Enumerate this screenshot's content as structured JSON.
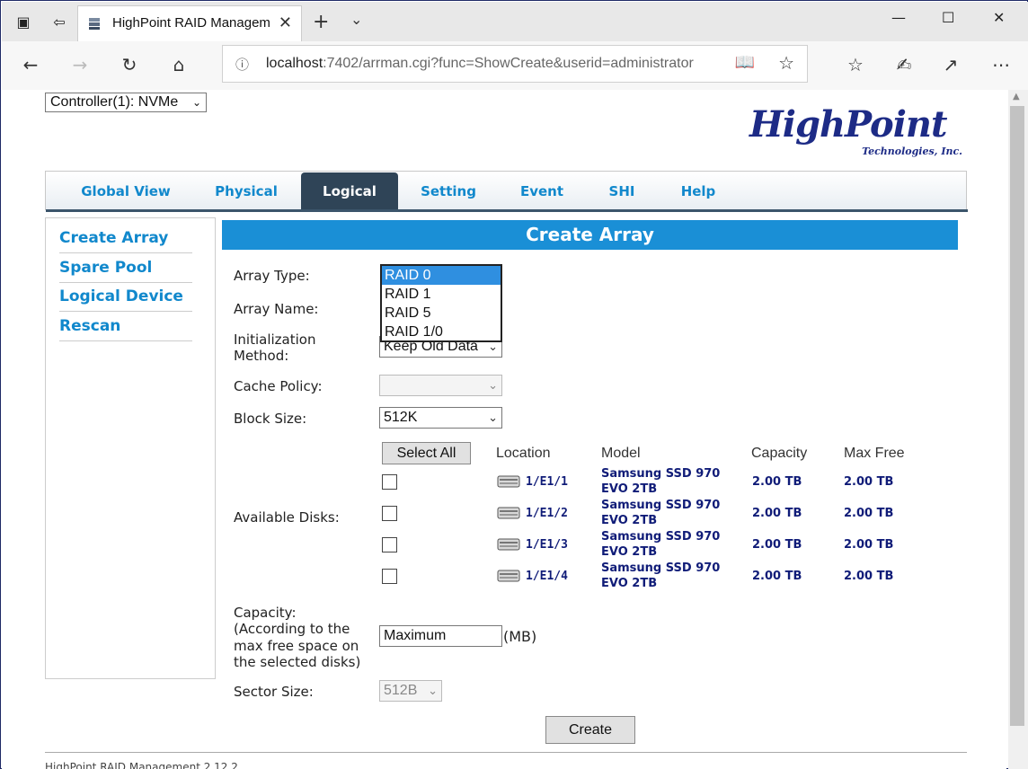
{
  "browser": {
    "tab_title": "HighPoint RAID Management",
    "url_host": "localhost",
    "url_rest": ":7402/arrman.cgi?func=ShowCreate&userid=administrator"
  },
  "page": {
    "controller_select": "Controller(1): NVMe",
    "logo_main": "HighPoint",
    "logo_sub": "Technologies, Inc.",
    "menu": [
      "Global View",
      "Physical",
      "Logical",
      "Setting",
      "Event",
      "SHI",
      "Help"
    ],
    "active_menu": "Logical",
    "sidebar": [
      "Create Array",
      "Spare Pool",
      "Logical Device",
      "Rescan"
    ],
    "heading": "Create Array",
    "labels": {
      "array_type": "Array Type:",
      "array_name": "Array Name:",
      "init_method_1": "Initialization",
      "init_method_2": "Method:",
      "cache_policy": "Cache Policy:",
      "block_size": "Block Size:",
      "available_disks": "Available Disks:",
      "capacity_1": "Capacity:",
      "capacity_2": "(According to the",
      "capacity_3": "max free space on",
      "capacity_4": "the selected disks)",
      "sector_size": "Sector Size:",
      "mb_unit": "(MB)"
    },
    "array_type_options": [
      "RAID 0",
      "RAID 1",
      "RAID 5",
      "RAID 1/0"
    ],
    "array_type_selected": "RAID 0",
    "init_method_value": "Keep Old Data",
    "cache_policy_value": "",
    "block_size_value": "512K",
    "select_all_label": "Select All",
    "disk_columns": [
      "Location",
      "Model",
      "Capacity",
      "Max Free"
    ],
    "disks": [
      {
        "location": "1/E1/1",
        "model_1": "Samsung SSD 970",
        "model_2": "EVO 2TB",
        "capacity": "2.00 TB",
        "max_free": "2.00 TB"
      },
      {
        "location": "1/E1/2",
        "model_1": "Samsung SSD 970",
        "model_2": "EVO 2TB",
        "capacity": "2.00 TB",
        "max_free": "2.00 TB"
      },
      {
        "location": "1/E1/3",
        "model_1": "Samsung SSD 970",
        "model_2": "EVO 2TB",
        "capacity": "2.00 TB",
        "max_free": "2.00 TB"
      },
      {
        "location": "1/E1/4",
        "model_1": "Samsung SSD 970",
        "model_2": "EVO 2TB",
        "capacity": "2.00 TB",
        "max_free": "2.00 TB"
      }
    ],
    "capacity_value": "Maximum",
    "sector_size_value": "512B",
    "create_label": "Create",
    "footer": "HighPoint RAID Management 2.12.2"
  }
}
